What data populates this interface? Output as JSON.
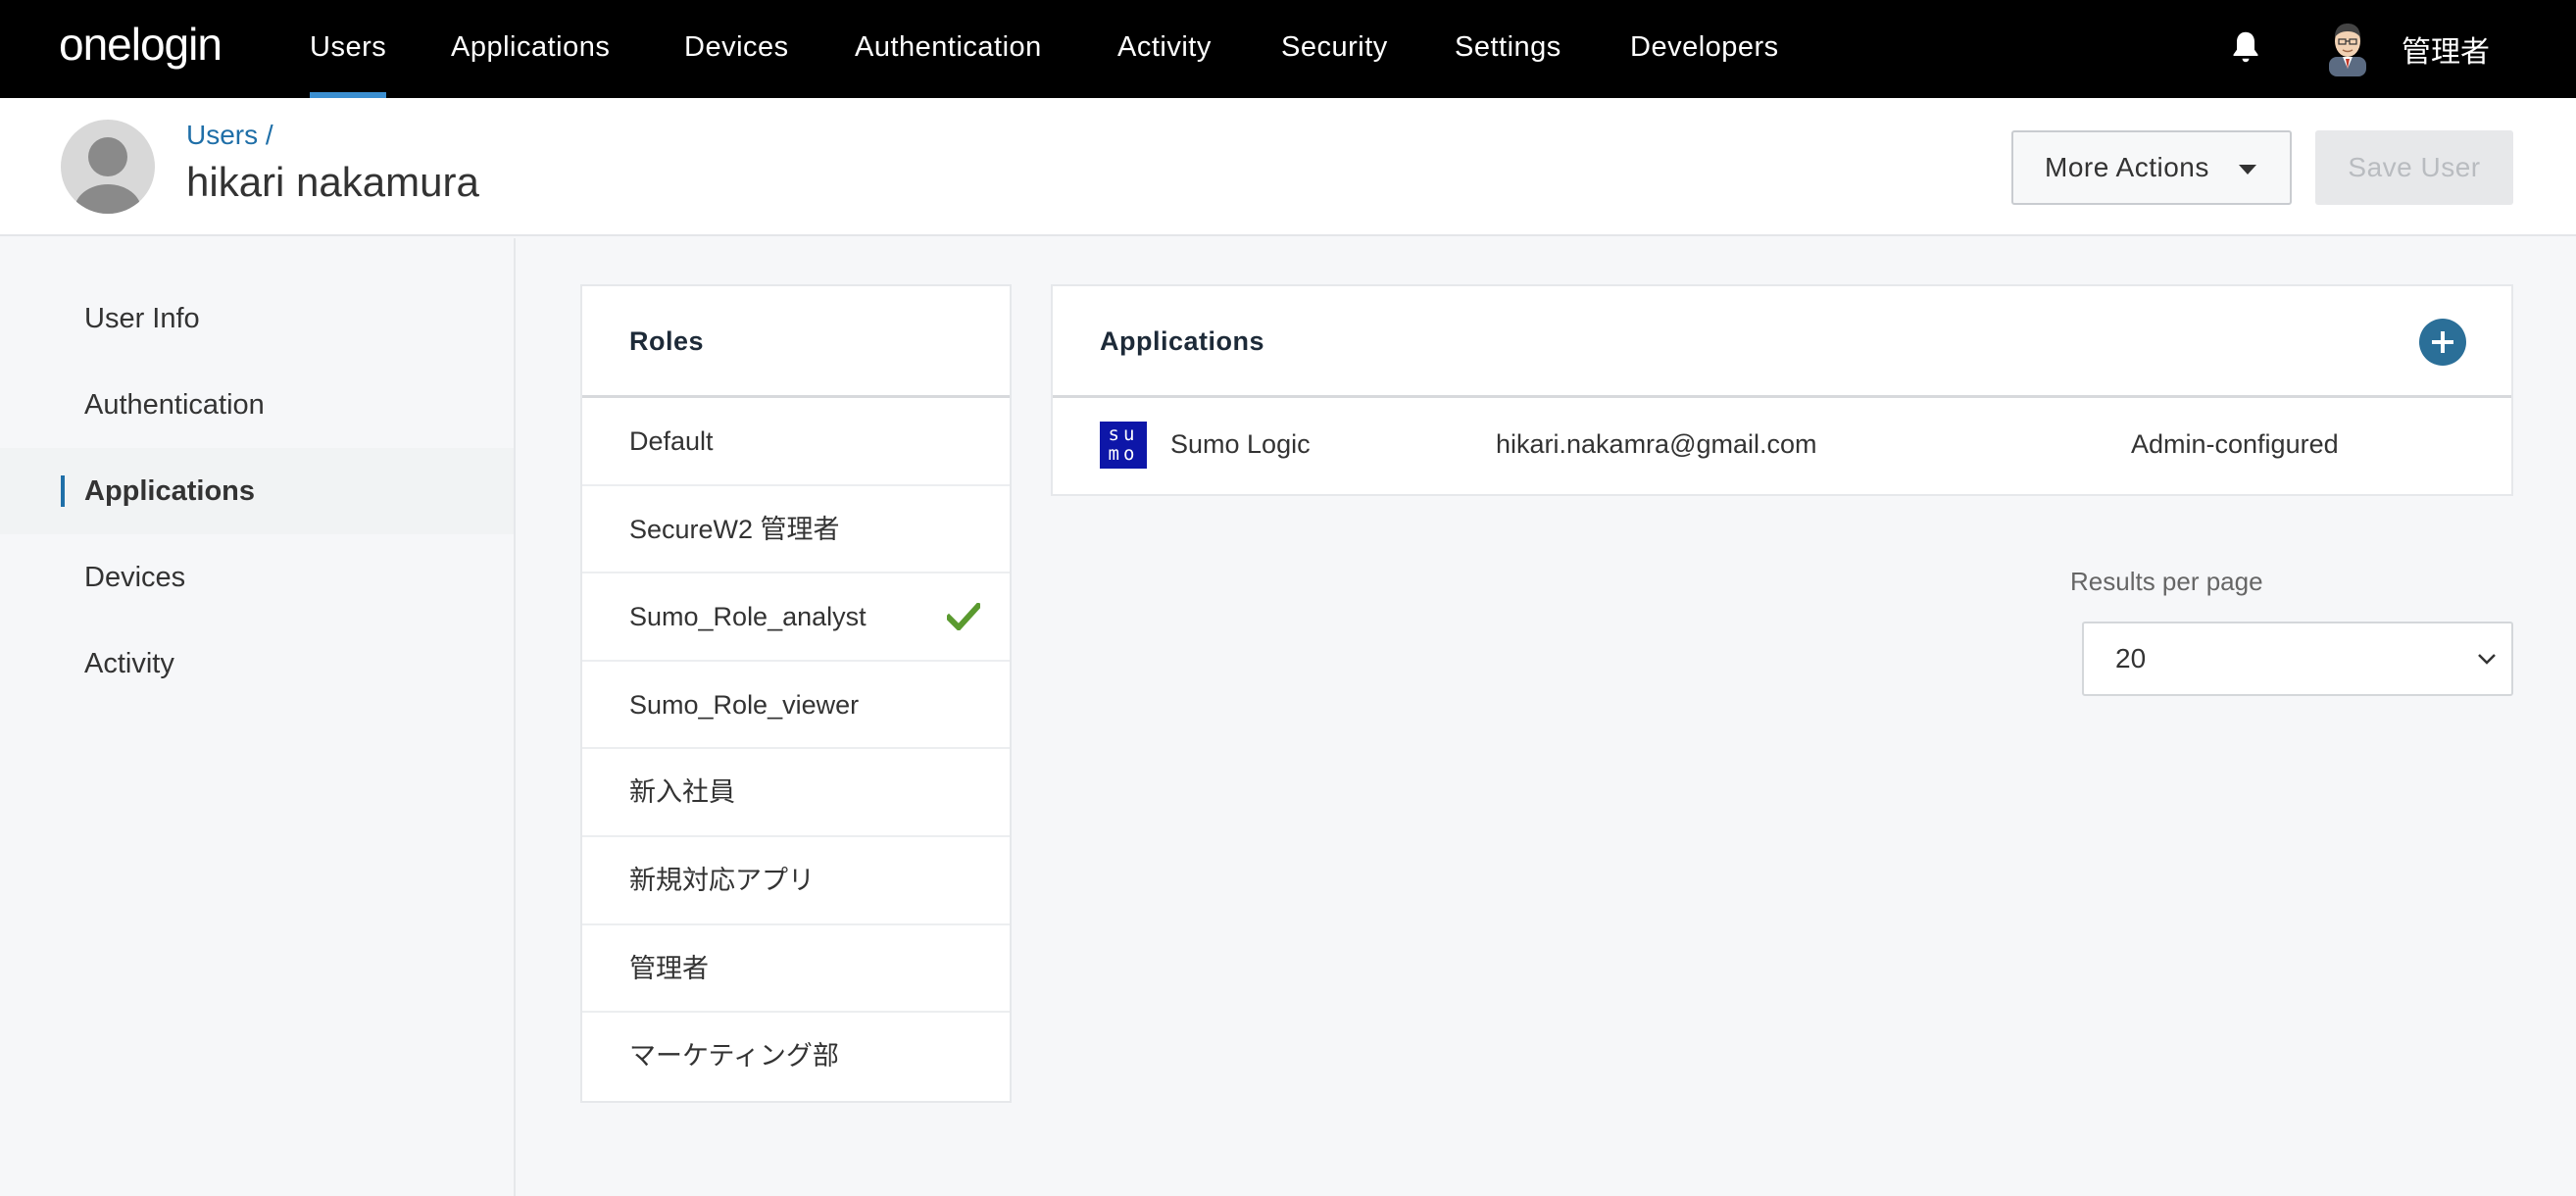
{
  "brand": {
    "logo_text": "onelogin"
  },
  "nav": {
    "items": [
      {
        "label": "Users",
        "active": true
      },
      {
        "label": "Applications"
      },
      {
        "label": "Devices"
      },
      {
        "label": "Authentication"
      },
      {
        "label": "Activity"
      },
      {
        "label": "Security"
      },
      {
        "label": "Settings"
      },
      {
        "label": "Developers"
      }
    ],
    "admin_name": "管理者"
  },
  "header": {
    "breadcrumb": "Users /",
    "title": "hikari nakamura",
    "more_actions_label": "More Actions",
    "save_label": "Save User"
  },
  "sidebar": {
    "items": [
      {
        "label": "User Info"
      },
      {
        "label": "Authentication"
      },
      {
        "label": "Applications",
        "active": true
      },
      {
        "label": "Devices"
      },
      {
        "label": "Activity"
      }
    ]
  },
  "roles": {
    "heading": "Roles",
    "items": [
      {
        "label": "Default",
        "checked": false
      },
      {
        "label": "SecureW2 管理者",
        "checked": false
      },
      {
        "label": "Sumo_Role_analyst",
        "checked": true
      },
      {
        "label": "Sumo_Role_viewer",
        "checked": false
      },
      {
        "label": "新入社員",
        "checked": false
      },
      {
        "label": "新規対応アプリ",
        "checked": false
      },
      {
        "label": "管理者",
        "checked": false
      },
      {
        "label": "マーケティング部",
        "checked": false
      }
    ]
  },
  "applications": {
    "heading": "Applications",
    "rows": [
      {
        "logo_text": "su mo",
        "name": "Sumo Logic",
        "login": "hikari.nakamra@gmail.com",
        "status": "Admin-configured"
      }
    ]
  },
  "pagination": {
    "results_label": "Results per page",
    "per_page": "20"
  },
  "colors": {
    "accent": "#3b8fd1",
    "link": "#1f6fa8",
    "add_button": "#2b6f98",
    "check": "#5a9a2f",
    "sumo_logo": "#0d16a8"
  }
}
